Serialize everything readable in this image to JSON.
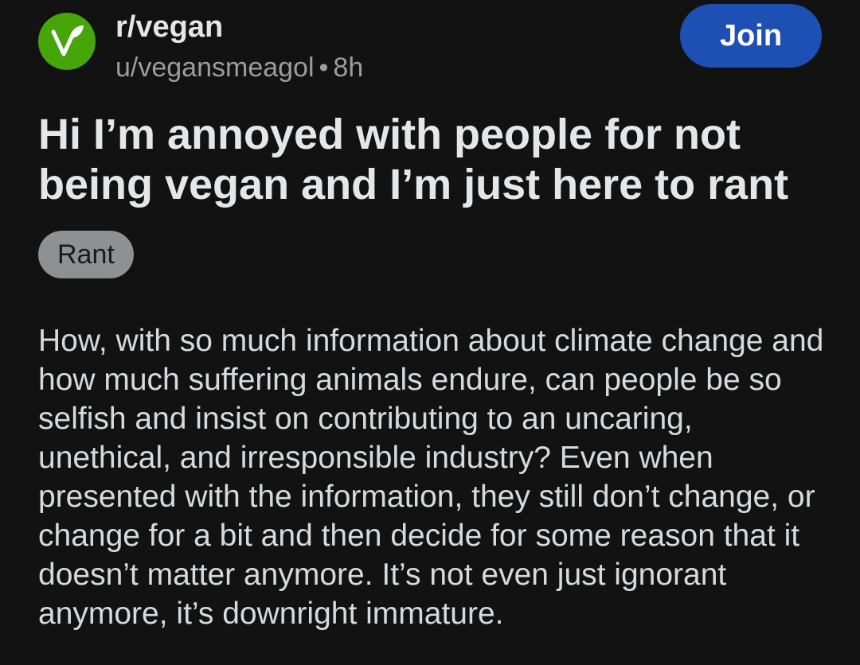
{
  "header": {
    "community_icon": "vegan-leaf-icon",
    "community_name": "r/vegan",
    "author": "u/vegansmeagol",
    "separator": "•",
    "time_ago": "8h",
    "join_label": "Join"
  },
  "post": {
    "title": "Hi I’m annoyed with people for not being vegan and I’m just here to rant",
    "flair": "Rant",
    "body": "How, with so much information about climate change and how much suffering animals endure, can people be so selfish and insist on contributing to an uncaring, unethical, and irresponsible industry? Even when presented with the information, they still don’t change, or change for a bit and then decide for some reason that it doesn’t matter anymore. It’s not even just ignorant anymore, it’s downright immature."
  },
  "colors": {
    "background": "#121212",
    "community_icon_bg": "#46a508",
    "join_button_bg": "#1e4fb4",
    "flair_bg": "#8e9092"
  }
}
